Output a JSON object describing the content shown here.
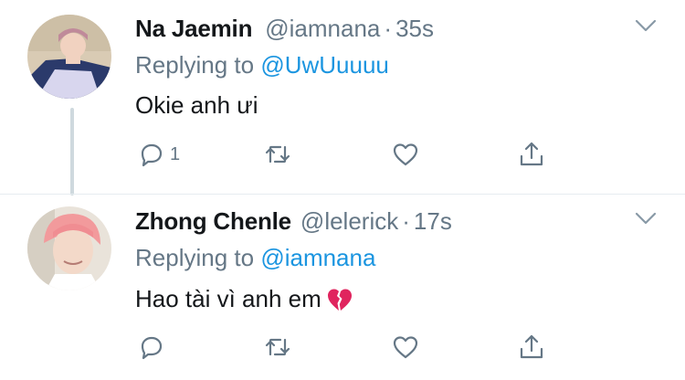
{
  "tweets": [
    {
      "name": "Na Jaemin",
      "handle": "@iamnana",
      "separator": "·",
      "time": "35s",
      "replying_prefix": "Replying to ",
      "replying_to": "@UwUuuuu",
      "text": "Okie anh ưi",
      "reply_count": "1"
    },
    {
      "name": "Zhong Chenle",
      "handle": "@lelerick",
      "separator": "·",
      "time": "17s",
      "replying_prefix": "Replying to ",
      "replying_to": "@iamnana",
      "text": "Hao tài vì anh em",
      "emoji": "💔",
      "reply_count": ""
    }
  ],
  "colors": {
    "mention": "#1b95e0",
    "muted": "#657786",
    "text": "#14171a",
    "heart_emoji": "#e0245e"
  },
  "icons": [
    "reply-icon",
    "retweet-icon",
    "like-icon",
    "share-icon",
    "chevron-down-icon",
    "broken-heart-icon"
  ]
}
